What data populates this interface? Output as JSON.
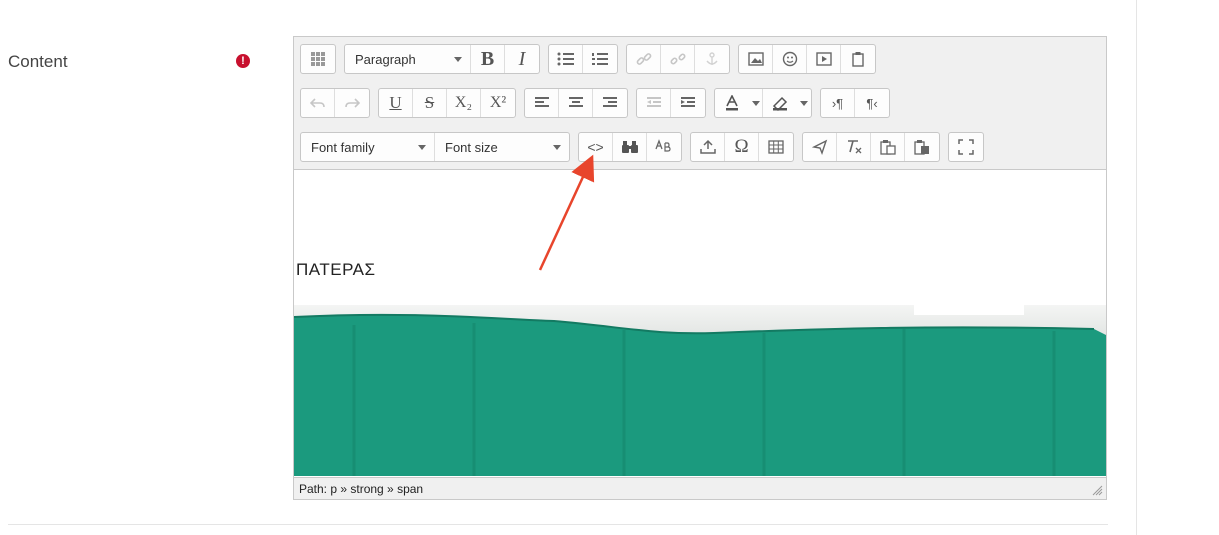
{
  "form": {
    "content_label": "Content",
    "required_mark": "!"
  },
  "editor": {
    "toolbar": {
      "row1": {
        "block_format": "Paragraph",
        "bold": "B",
        "italic": "I"
      },
      "row2": {
        "underline": "U",
        "strikethrough": "S",
        "subscript": "X₂",
        "superscript": "X²",
        "ltr": "›¶",
        "rtl": "¶‹"
      },
      "row3": {
        "font_family": "Font family",
        "font_size": "Font size",
        "code": "<>",
        "omega": "Ω"
      }
    },
    "content": {
      "heading_text": "ΠΑΤΕΡΑΣ"
    },
    "statusbar": {
      "path_text": "Path: p » strong » span"
    }
  },
  "colors": {
    "annotation_arrow": "#e8452c",
    "photo_curtain": "#1b9a7e",
    "required_icon": "#c8102e"
  }
}
